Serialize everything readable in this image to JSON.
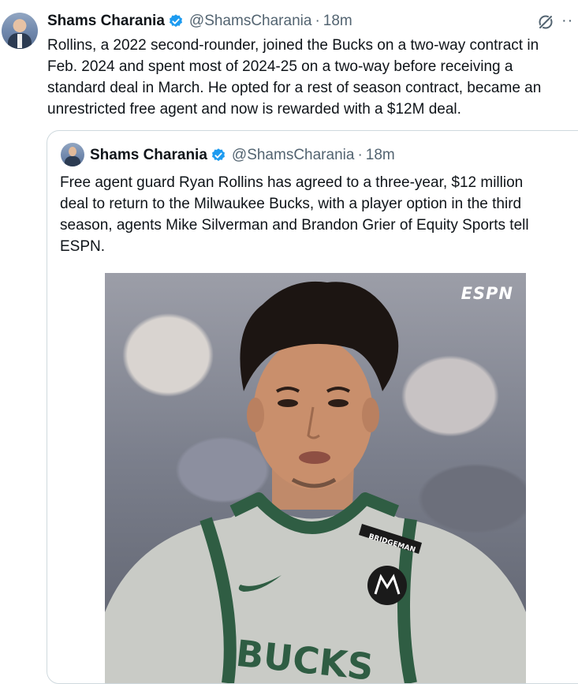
{
  "tweet": {
    "author_name": "Shams Charania",
    "handle": "@ShamsCharania",
    "separator": "·",
    "time": "18m",
    "text": "Rollins, a 2022 second-rounder, joined the Bucks on a two-way contract in\nFeb. 2024 and spent most of 2024-25 on a two-way before receiving a\nstandard deal in March. He opted for a rest of season contract, became an\nunrestricted free agent and now is rewarded with a $12M deal."
  },
  "quoted_tweet": {
    "author_name": "Shams Charania",
    "handle": "@ShamsCharania",
    "separator": "·",
    "time": "18m",
    "text": "Free agent guard Ryan Rollins has agreed to a three-year, $12 million\ndeal to return to the Milwaukee Bucks, with a player option in the third\nseason, agents Mike Silverman and Brandon Grier of Equity Sports tell\nESPN.",
    "media": {
      "watermark": "ESPN",
      "jersey_patch": "BRIDGEMAN",
      "jersey_text": "BUCKS"
    }
  },
  "icons": {
    "verified": "verified-badge-icon",
    "grok": "grok-icon",
    "more": "more-icon"
  },
  "colors": {
    "verified_blue": "#1d9bf0",
    "secondary_text": "#536471",
    "border": "#cfd9de",
    "jersey_green": "#2f5d43",
    "jersey_gray": "#c9cbc6"
  }
}
